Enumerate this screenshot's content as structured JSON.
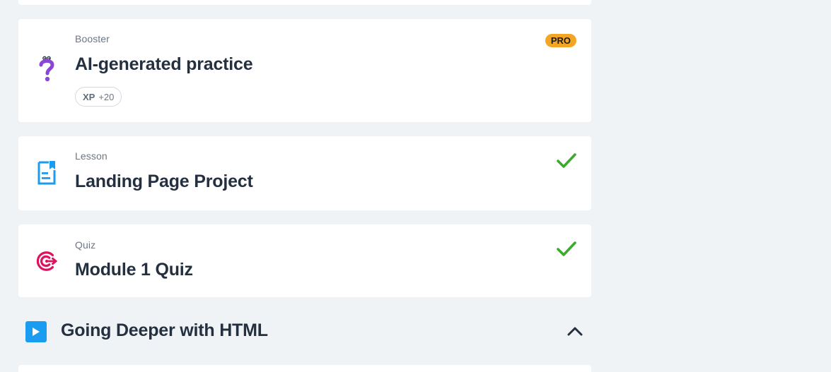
{
  "items": {
    "booster": {
      "type_label": "Booster",
      "title": "AI-generated practice",
      "badge": "PRO",
      "xp_label": "XP",
      "xp_value": "+20",
      "icon": "question-mark-character-icon"
    },
    "lesson": {
      "type_label": "Lesson",
      "title": "Landing Page Project",
      "status": "completed",
      "icon": "document-bookmark-icon"
    },
    "quiz": {
      "type_label": "Quiz",
      "title": "Module 1 Quiz",
      "status": "completed",
      "icon": "target-icon"
    }
  },
  "section": {
    "title": "Going Deeper with HTML",
    "icon": "play-icon",
    "state": "expanded"
  },
  "colors": {
    "page_bg": "#f0f3f6",
    "pro_badge": "#f5a524",
    "check": "#3daa2f",
    "lesson_icon": "#1a9cf0",
    "quiz_icon": "#e0115f",
    "booster_icon": "#8a47d6",
    "play_square": "#1a9cf0"
  }
}
